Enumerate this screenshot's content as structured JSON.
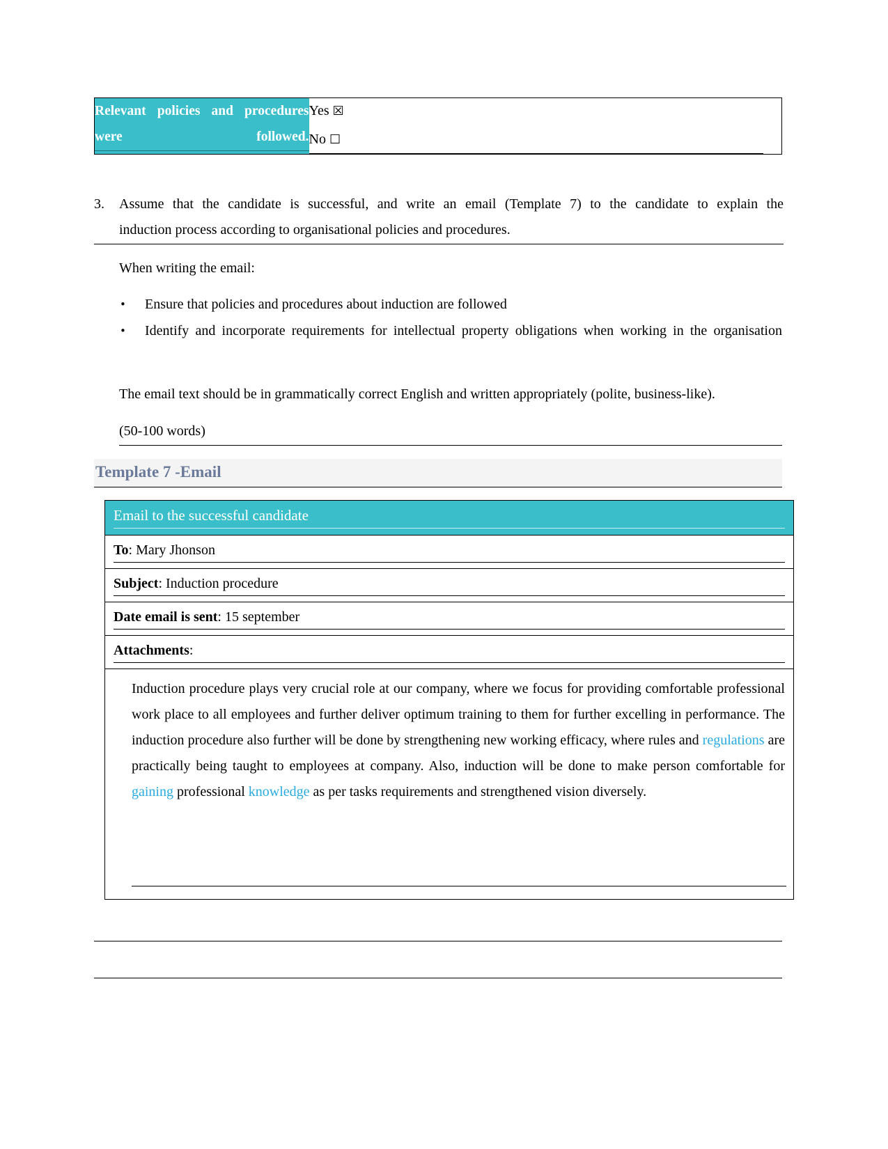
{
  "checklist": {
    "label": "Relevant policies and procedures were followed.",
    "options": [
      {
        "text": "Yes",
        "box": "☒",
        "checked": true
      },
      {
        "text": "No",
        "box": "☐",
        "checked": false
      }
    ],
    "label_bg": "#3ABECA",
    "label_color": "#FFFFFF"
  },
  "question": {
    "number": "3.",
    "line1": "Assume that the candidate is successful, and write an email (Template 7) to the candidate to explain the",
    "line2": "induction process according to organisational policies and procedures."
  },
  "instructions": {
    "intro": "When writing the email:",
    "bullets": [
      "Ensure that policies and procedures about induction are followed",
      "Identify and incorporate requirements for intellectual property obligations when working in the organisation"
    ],
    "bullet_glyph": "•",
    "closing": "The email text should be in grammatically correct English and written appropriately (polite, business-like).",
    "word_count": "(50-100 words)"
  },
  "template_heading": {
    "text": "Template 7 -Email",
    "color": "#6B7A99"
  },
  "email": {
    "header": "Email to the successful candidate",
    "header_bg": "#3ABECA",
    "fields": [
      {
        "label": "To",
        "separator": ": ",
        "value": "Mary Jhonson"
      },
      {
        "label": "Subject",
        "separator": ": ",
        "value": "Induction procedure"
      },
      {
        "label": "Date email is sent",
        "separator": ": ",
        "value": "15 september"
      },
      {
        "label": "Attachments",
        "separator": ":",
        "value": ""
      }
    ],
    "body_segments": [
      {
        "text": "Induction procedure plays very crucial role at our company, where we focus for providing comfortable professional work place to all employees and further deliver optimum training to them for further excelling in performance. The induction procedure also further will be done by strengthening new working efficacy, where rules and ",
        "highlight": false
      },
      {
        "text": "regulations",
        "highlight": true
      },
      {
        "text": " are practically being taught to employees at company. Also, induction will be done to make person comfortable for ",
        "highlight": false
      },
      {
        "text": "gaining",
        "highlight": true
      },
      {
        "text": " professional ",
        "highlight": false
      },
      {
        "text": "knowledge",
        "highlight": true
      },
      {
        "text": " as per tasks requirements and strengthened vision diversely.",
        "highlight": false
      }
    ],
    "highlight_color": "#29ABE2"
  }
}
